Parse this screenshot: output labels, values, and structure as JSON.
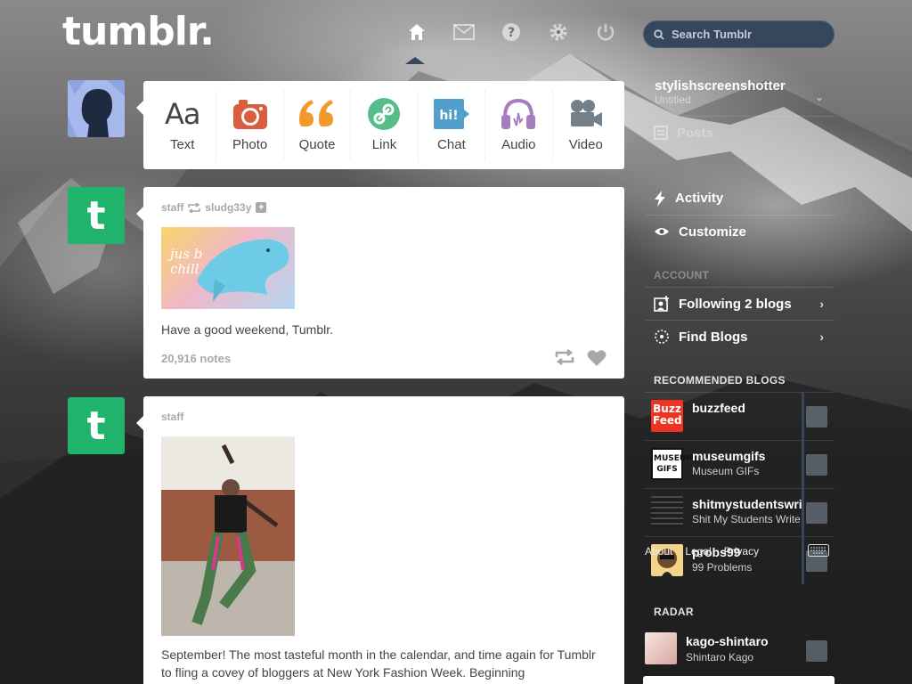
{
  "app": {
    "logo": "tumblr."
  },
  "topnav": {
    "items": [
      "home",
      "inbox",
      "help",
      "settings",
      "logout"
    ]
  },
  "search": {
    "placeholder": "Search Tumblr"
  },
  "post_types": [
    {
      "label": "Text",
      "icon": "text-icon",
      "color": "#444444"
    },
    {
      "label": "Photo",
      "icon": "camera-icon",
      "color": "#d95e40"
    },
    {
      "label": "Quote",
      "icon": "quote-icon",
      "color": "#f2992e"
    },
    {
      "label": "Link",
      "icon": "link-icon",
      "color": "#56bc8a"
    },
    {
      "label": "Chat",
      "icon": "chat-icon",
      "color": "#529ecc"
    },
    {
      "label": "Audio",
      "icon": "headphones-icon",
      "color": "#a77dc2"
    },
    {
      "label": "Video",
      "icon": "video-camera-icon",
      "color": "#748089"
    }
  ],
  "posts": [
    {
      "author": "staff",
      "reblogged_from": "sludg33y",
      "image_caption": "jus b chill",
      "text": "Have a good weekend, Tumblr.",
      "notes": "20,916 notes"
    },
    {
      "author": "staff",
      "text": "September! The most tasteful month in the calendar, and time again for Tumblr to fling a covey of bloggers at New York Fashion Week. Beginning"
    }
  ],
  "sidebar": {
    "blog_name": "stylishscreenshotter",
    "blog_sub": "Untitled",
    "rows": [
      {
        "label": "Posts",
        "icon": "posts-icon"
      },
      {
        "label": "Activity",
        "icon": "lightning-icon"
      },
      {
        "label": "Customize",
        "icon": "eye-icon"
      }
    ],
    "account_heading": "ACCOUNT",
    "following": "Following 2 blogs",
    "find_blogs": "Find Blogs",
    "recommended_heading": "RECOMMENDED BLOGS",
    "recommended": [
      {
        "name": "buzzfeed",
        "sub": "",
        "thumb_text": "Buzz Feed",
        "color": "#ee3322"
      },
      {
        "name": "museumgifs",
        "sub": "Museum GIFs",
        "thumb_text": "MUSEUM GIFS",
        "color": "#111111"
      },
      {
        "name": "shitmystudentswrite",
        "sub": "Shit My Students Write",
        "thumb_text": "",
        "color": "#2a2a2a"
      },
      {
        "name": "probs99",
        "sub": "99 Problems",
        "thumb_text": "",
        "color": "#f2d48a"
      }
    ],
    "footer": [
      "About",
      "Legal",
      "Privacy"
    ],
    "radar_heading": "RADAR",
    "radar": {
      "name": "kago-shintaro",
      "sub": "Shintaro Kago"
    }
  },
  "colors": {
    "nav_blue": "#36465d",
    "tumblr_green": "#1fb36b"
  }
}
